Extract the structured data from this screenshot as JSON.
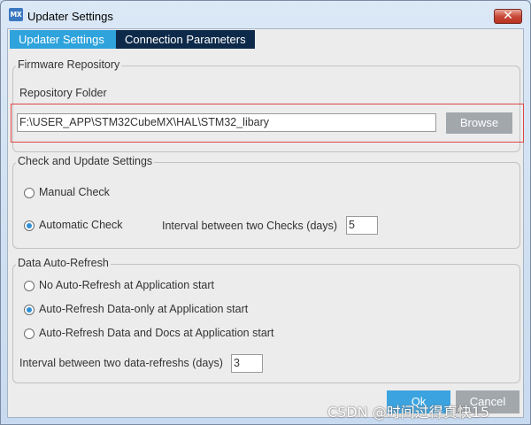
{
  "window": {
    "title": "Updater Settings",
    "app_icon_text": "MX",
    "close_glyph": "✕"
  },
  "tabs": [
    {
      "label": "Updater Settings",
      "active": true
    },
    {
      "label": "Connection Parameters",
      "active": false
    }
  ],
  "firmware_repository": {
    "legend": "Firmware Repository",
    "folder_label": "Repository Folder",
    "folder_value": "F:\\USER_APP\\STM32CubeMX\\HAL\\STM32_libary",
    "browse_label": "Browse"
  },
  "check_update": {
    "legend": "Check and Update Settings",
    "manual_label": "Manual Check",
    "manual_selected": false,
    "automatic_label": "Automatic Check",
    "automatic_selected": true,
    "interval_label": "Interval between two Checks (days)",
    "interval_value": "5"
  },
  "data_auto_refresh": {
    "legend": "Data Auto-Refresh",
    "options": [
      {
        "label": "No Auto-Refresh at Application start",
        "selected": false
      },
      {
        "label": "Auto-Refresh Data-only at Application start",
        "selected": true
      },
      {
        "label": "Auto-Refresh Data and Docs at Application start",
        "selected": false
      }
    ],
    "interval_label": "Interval between two data-refreshs (days)",
    "interval_value": "3"
  },
  "footer": {
    "ok_label": "Ok",
    "cancel_label": "Cancel"
  },
  "watermark": "CSDN @时间过得真快15",
  "colors": {
    "tab_active": "#2ea3dc",
    "tab_inactive": "#0e2a4a",
    "highlight_border": "#e04545",
    "button_primary": "#3ba3e0",
    "button_secondary": "#a2a7ac"
  }
}
